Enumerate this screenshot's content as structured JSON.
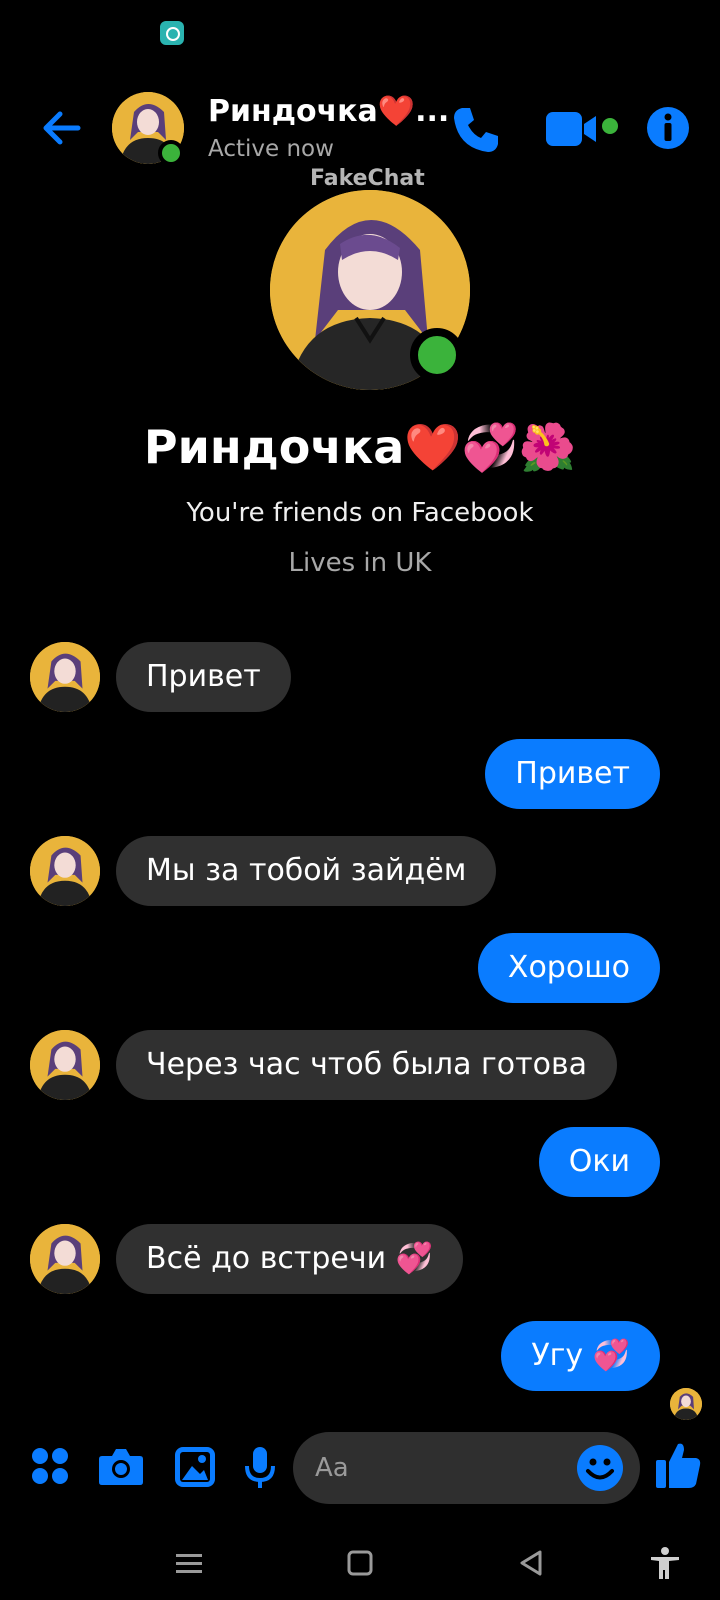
{
  "header": {
    "contact_name": "Риндочка❤️...",
    "status": "Active now"
  },
  "watermark": "FakeChat",
  "profile": {
    "name": "Риндочка❤️💞🌺",
    "friends_text": "You're friends on Facebook",
    "lives_text": "Lives in UK"
  },
  "messages": [
    {
      "side": "in",
      "text": "Привет"
    },
    {
      "side": "out",
      "text": "Привет"
    },
    {
      "side": "in",
      "text": "Мы за тобой зайдём"
    },
    {
      "side": "out",
      "text": "Хорошо"
    },
    {
      "side": "in",
      "text": "Через час чтоб была готова"
    },
    {
      "side": "out",
      "text": "Оки"
    },
    {
      "side": "in",
      "text": "Всё до встречи 💞"
    },
    {
      "side": "out",
      "text": "Угу 💞"
    }
  ],
  "composer": {
    "placeholder": "Aa"
  },
  "icons": {
    "back": "arrow-left-icon",
    "call": "phone-icon",
    "video": "video-camera-icon",
    "info": "info-icon",
    "apps": "four-dots-icon",
    "camera": "camera-icon",
    "gallery": "image-icon",
    "mic": "microphone-icon",
    "emoji": "smiley-icon",
    "like": "thumbs-up-icon"
  },
  "colors": {
    "accent": "#0a7cff",
    "online": "#3bb33b",
    "incoming_bubble": "#303030",
    "background": "#000000"
  }
}
